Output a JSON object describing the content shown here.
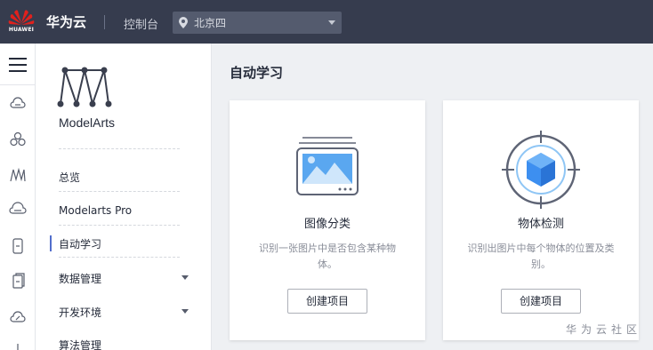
{
  "topbar": {
    "logo_text": "HUAWEI",
    "brand": "华为云",
    "console": "控制台",
    "region": "北京四"
  },
  "rail": {
    "icons": [
      "menu-icon",
      "cloud-server-icon",
      "cluster-icon",
      "modelarts-icon",
      "database-icon",
      "phone-icon",
      "document-icon",
      "cloud-link-icon"
    ]
  },
  "nav": {
    "service_name": "ModelArts",
    "items": [
      {
        "label": "总览"
      },
      {
        "label": "Modelarts Pro"
      },
      {
        "label": "自动学习"
      },
      {
        "label": "数据管理"
      },
      {
        "label": "开发环境"
      },
      {
        "label": "算法管理"
      }
    ]
  },
  "main": {
    "title": "自动学习",
    "cards": [
      {
        "title": "图像分类",
        "desc": "识别一张图片中是否包含某种物体。",
        "button": "创建项目"
      },
      {
        "title": "物体检测",
        "desc": "识别出图片中每个物体的位置及类别。",
        "button": "创建项目"
      }
    ]
  },
  "watermark": "华为云社区",
  "colors": {
    "topbar": "#363c4e",
    "accent": "#526ecc",
    "page_bg": "#eef0f3"
  }
}
